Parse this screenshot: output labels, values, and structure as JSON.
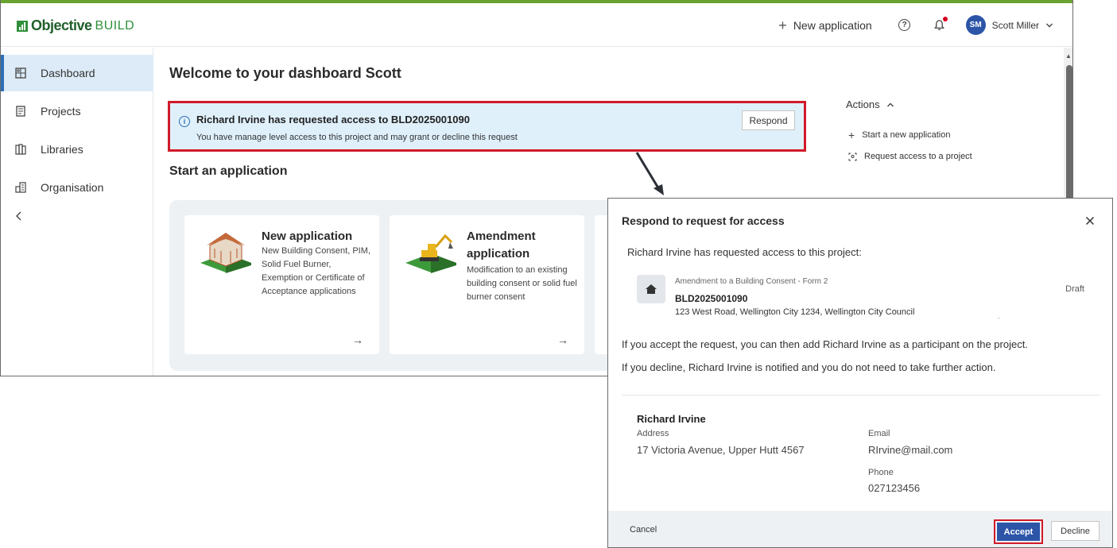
{
  "header": {
    "logo_name": "Objective",
    "logo_sub": "BUILD",
    "new_application_label": "New application",
    "user_initials": "SM",
    "user_name": "Scott Miller"
  },
  "sidebar": {
    "items": [
      {
        "label": "Dashboard",
        "icon": "dashboard-icon",
        "active": true
      },
      {
        "label": "Projects",
        "icon": "projects-icon"
      },
      {
        "label": "Libraries",
        "icon": "libraries-icon"
      },
      {
        "label": "Organisation",
        "icon": "organisation-icon"
      }
    ]
  },
  "main": {
    "welcome": "Welcome to your dashboard Scott",
    "alert": {
      "title": "Richard Irvine has requested access to BLD2025001090",
      "text": "You have manage level access to this project and may grant or decline this request",
      "button": "Respond"
    },
    "start_title": "Start an application",
    "cards": [
      {
        "title": "New application",
        "desc": "New Building Consent, PIM, Solid Fuel Burner, Exemption or Certificate of Acceptance applications"
      },
      {
        "title": "Amendment application",
        "desc": "Modification to an existing building consent or solid fuel burner consent"
      }
    ]
  },
  "actions": {
    "title": "Actions",
    "items": [
      "Start a new application",
      "Request access to a project"
    ]
  },
  "modal": {
    "title": "Respond to request for access",
    "intro": "Richard Irvine has requested access to this project:",
    "project": {
      "type": "Amendment to a Building Consent - Form 2",
      "number": "BLD2025001090",
      "address": "123 West Road, Wellington City 1234, Wellington City Council",
      "status": "Draft"
    },
    "accept_text": "If you accept the request, you can then add  Richard Irvine  as a participant on the project.",
    "decline_text": "If you decline,  Richard Irvine  is notified and you do not need to take further action.",
    "person": {
      "name": "Richard Irvine",
      "address_label": "Address",
      "address": "17 Victoria Avenue,  Upper Hutt 4567",
      "email_label": "Email",
      "email": "RIrvine@mail.com",
      "phone_label": "Phone",
      "phone": "027123456"
    },
    "cancel": "Cancel",
    "accept": "Accept",
    "decline": "Decline"
  },
  "colors": {
    "accent_green": "#6aa32f",
    "primary_blue": "#2c55a8",
    "highlight_red": "#d11a2a",
    "alert_bg": "#dff0fb"
  }
}
